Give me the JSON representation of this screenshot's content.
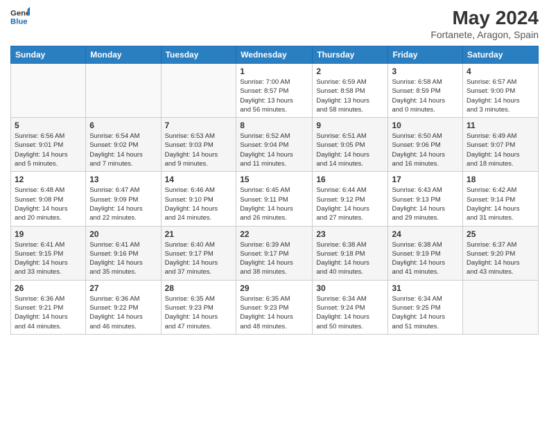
{
  "header": {
    "logo_general": "General",
    "logo_blue": "Blue",
    "month_year": "May 2024",
    "location": "Fortanete, Aragon, Spain"
  },
  "days_of_week": [
    "Sunday",
    "Monday",
    "Tuesday",
    "Wednesday",
    "Thursday",
    "Friday",
    "Saturday"
  ],
  "weeks": [
    [
      {
        "day": "",
        "info": ""
      },
      {
        "day": "",
        "info": ""
      },
      {
        "day": "",
        "info": ""
      },
      {
        "day": "1",
        "info": "Sunrise: 7:00 AM\nSunset: 8:57 PM\nDaylight: 13 hours\nand 56 minutes."
      },
      {
        "day": "2",
        "info": "Sunrise: 6:59 AM\nSunset: 8:58 PM\nDaylight: 13 hours\nand 58 minutes."
      },
      {
        "day": "3",
        "info": "Sunrise: 6:58 AM\nSunset: 8:59 PM\nDaylight: 14 hours\nand 0 minutes."
      },
      {
        "day": "4",
        "info": "Sunrise: 6:57 AM\nSunset: 9:00 PM\nDaylight: 14 hours\nand 3 minutes."
      }
    ],
    [
      {
        "day": "5",
        "info": "Sunrise: 6:56 AM\nSunset: 9:01 PM\nDaylight: 14 hours\nand 5 minutes."
      },
      {
        "day": "6",
        "info": "Sunrise: 6:54 AM\nSunset: 9:02 PM\nDaylight: 14 hours\nand 7 minutes."
      },
      {
        "day": "7",
        "info": "Sunrise: 6:53 AM\nSunset: 9:03 PM\nDaylight: 14 hours\nand 9 minutes."
      },
      {
        "day": "8",
        "info": "Sunrise: 6:52 AM\nSunset: 9:04 PM\nDaylight: 14 hours\nand 11 minutes."
      },
      {
        "day": "9",
        "info": "Sunrise: 6:51 AM\nSunset: 9:05 PM\nDaylight: 14 hours\nand 14 minutes."
      },
      {
        "day": "10",
        "info": "Sunrise: 6:50 AM\nSunset: 9:06 PM\nDaylight: 14 hours\nand 16 minutes."
      },
      {
        "day": "11",
        "info": "Sunrise: 6:49 AM\nSunset: 9:07 PM\nDaylight: 14 hours\nand 18 minutes."
      }
    ],
    [
      {
        "day": "12",
        "info": "Sunrise: 6:48 AM\nSunset: 9:08 PM\nDaylight: 14 hours\nand 20 minutes."
      },
      {
        "day": "13",
        "info": "Sunrise: 6:47 AM\nSunset: 9:09 PM\nDaylight: 14 hours\nand 22 minutes."
      },
      {
        "day": "14",
        "info": "Sunrise: 6:46 AM\nSunset: 9:10 PM\nDaylight: 14 hours\nand 24 minutes."
      },
      {
        "day": "15",
        "info": "Sunrise: 6:45 AM\nSunset: 9:11 PM\nDaylight: 14 hours\nand 26 minutes."
      },
      {
        "day": "16",
        "info": "Sunrise: 6:44 AM\nSunset: 9:12 PM\nDaylight: 14 hours\nand 27 minutes."
      },
      {
        "day": "17",
        "info": "Sunrise: 6:43 AM\nSunset: 9:13 PM\nDaylight: 14 hours\nand 29 minutes."
      },
      {
        "day": "18",
        "info": "Sunrise: 6:42 AM\nSunset: 9:14 PM\nDaylight: 14 hours\nand 31 minutes."
      }
    ],
    [
      {
        "day": "19",
        "info": "Sunrise: 6:41 AM\nSunset: 9:15 PM\nDaylight: 14 hours\nand 33 minutes."
      },
      {
        "day": "20",
        "info": "Sunrise: 6:41 AM\nSunset: 9:16 PM\nDaylight: 14 hours\nand 35 minutes."
      },
      {
        "day": "21",
        "info": "Sunrise: 6:40 AM\nSunset: 9:17 PM\nDaylight: 14 hours\nand 37 minutes."
      },
      {
        "day": "22",
        "info": "Sunrise: 6:39 AM\nSunset: 9:17 PM\nDaylight: 14 hours\nand 38 minutes."
      },
      {
        "day": "23",
        "info": "Sunrise: 6:38 AM\nSunset: 9:18 PM\nDaylight: 14 hours\nand 40 minutes."
      },
      {
        "day": "24",
        "info": "Sunrise: 6:38 AM\nSunset: 9:19 PM\nDaylight: 14 hours\nand 41 minutes."
      },
      {
        "day": "25",
        "info": "Sunrise: 6:37 AM\nSunset: 9:20 PM\nDaylight: 14 hours\nand 43 minutes."
      }
    ],
    [
      {
        "day": "26",
        "info": "Sunrise: 6:36 AM\nSunset: 9:21 PM\nDaylight: 14 hours\nand 44 minutes."
      },
      {
        "day": "27",
        "info": "Sunrise: 6:36 AM\nSunset: 9:22 PM\nDaylight: 14 hours\nand 46 minutes."
      },
      {
        "day": "28",
        "info": "Sunrise: 6:35 AM\nSunset: 9:23 PM\nDaylight: 14 hours\nand 47 minutes."
      },
      {
        "day": "29",
        "info": "Sunrise: 6:35 AM\nSunset: 9:23 PM\nDaylight: 14 hours\nand 48 minutes."
      },
      {
        "day": "30",
        "info": "Sunrise: 6:34 AM\nSunset: 9:24 PM\nDaylight: 14 hours\nand 50 minutes."
      },
      {
        "day": "31",
        "info": "Sunrise: 6:34 AM\nSunset: 9:25 PM\nDaylight: 14 hours\nand 51 minutes."
      },
      {
        "day": "",
        "info": ""
      }
    ]
  ]
}
